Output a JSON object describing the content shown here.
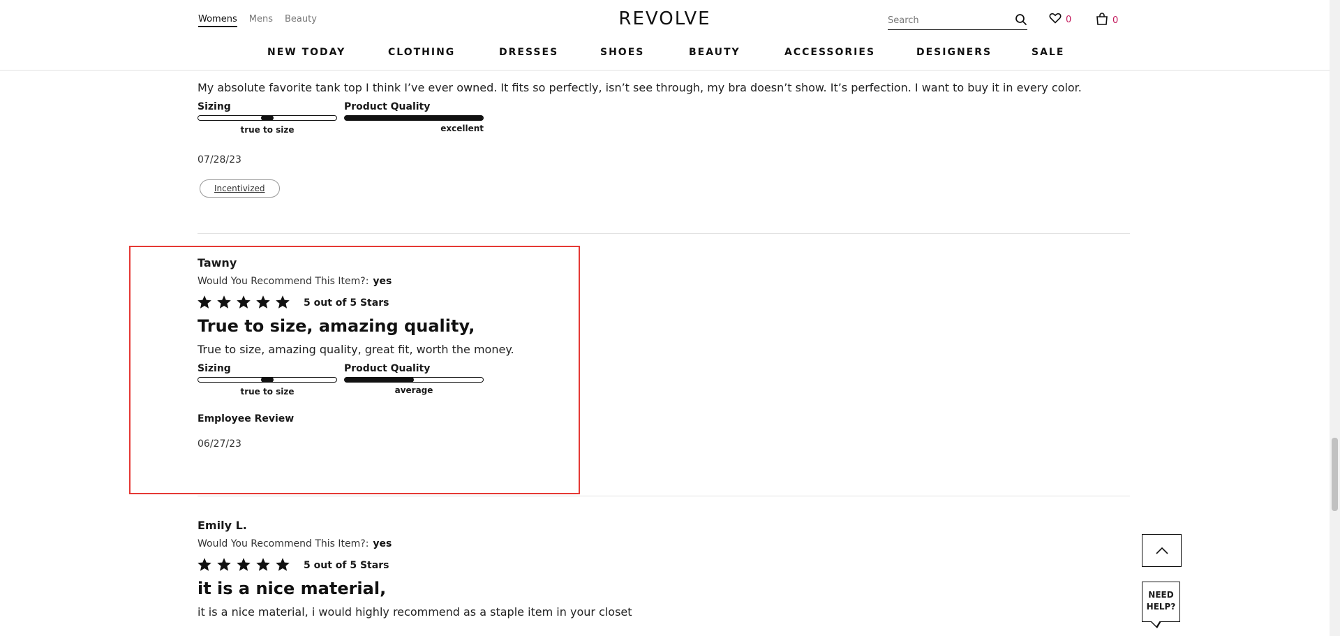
{
  "header": {
    "gender_tabs": [
      "Womens",
      "Mens",
      "Beauty"
    ],
    "active_gender": "Womens",
    "logo": "REVOLVE",
    "search_placeholder": "Search",
    "wishlist_count": "0",
    "bag_count": "0",
    "nav": [
      "NEW TODAY",
      "CLOTHING",
      "DRESSES",
      "SHOES",
      "BEAUTY",
      "ACCESSORIES",
      "DESIGNERS",
      "SALE"
    ]
  },
  "reviews": [
    {
      "body": "My absolute favorite tank top I think I’ve ever owned. It fits so perfectly, isn’t see through, my bra doesn’t show. It’s perfection. I want to buy it in every color.",
      "sizing_label": "Sizing",
      "sizing_caption": "true to size",
      "sizing_value": 0.5,
      "quality_label": "Product Quality",
      "quality_caption": "excellent",
      "quality_value": 1.0,
      "date": "07/28/23",
      "badge": "Incentivized"
    },
    {
      "name": "Tawny",
      "recommend_label": "Would You Recommend This Item?:",
      "recommend_value": "yes",
      "rating": 5,
      "rating_label": "5 out of 5 Stars",
      "title": "True to size, amazing quality,",
      "body": "True to size, amazing quality, great fit, worth the money.",
      "sizing_label": "Sizing",
      "sizing_caption": "true to size",
      "sizing_value": 0.5,
      "quality_label": "Product Quality",
      "quality_caption": "average",
      "quality_value": 0.5,
      "employee_label": "Employee Review",
      "date": "06/27/23"
    },
    {
      "name": "Emily L.",
      "recommend_label": "Would You Recommend This Item?:",
      "recommend_value": "yes",
      "rating": 5,
      "rating_label": "5 out of 5 Stars",
      "title": "it is a nice material,",
      "body": "it is a nice material, i would highly recommend as a staple item in your closet"
    }
  ],
  "floating": {
    "help_line1": "NEED",
    "help_line2": "HELP?"
  },
  "colors": {
    "highlight": "#e53935",
    "count": "#c2185b"
  }
}
